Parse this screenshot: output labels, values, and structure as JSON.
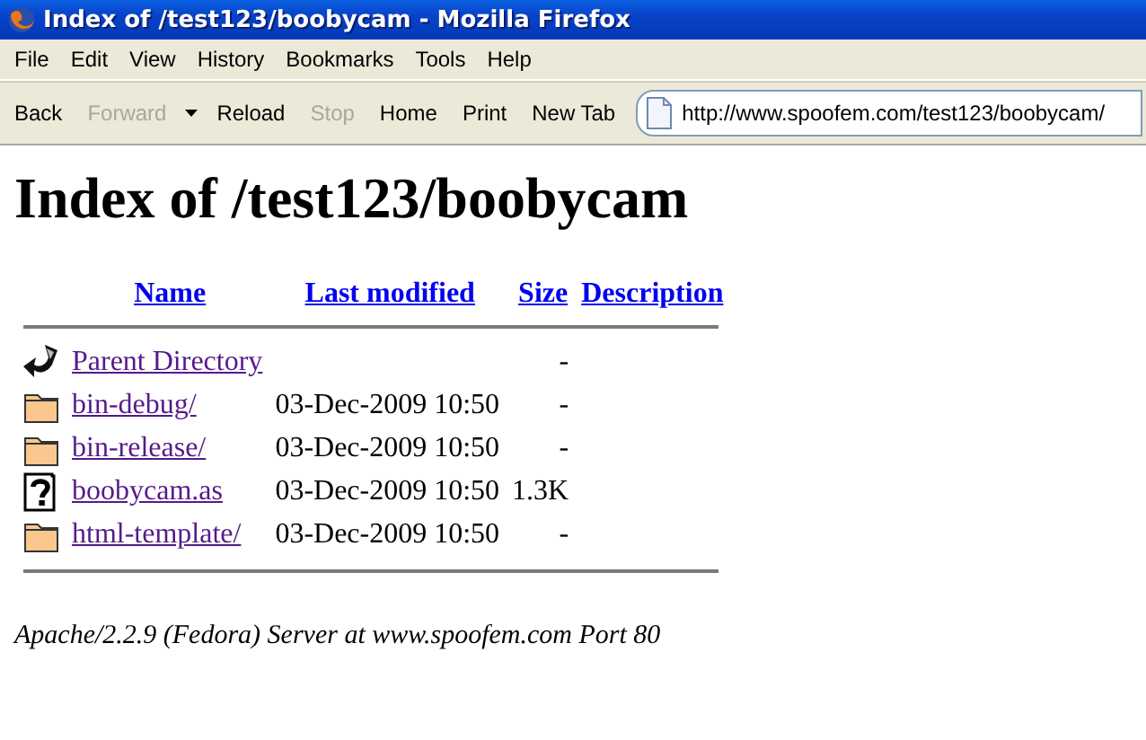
{
  "window": {
    "title": "Index of /test123/boobycam - Mozilla Firefox"
  },
  "menu": [
    "File",
    "Edit",
    "View",
    "History",
    "Bookmarks",
    "Tools",
    "Help"
  ],
  "toolbar": [
    {
      "label": "Back",
      "disabled": false
    },
    {
      "label": "Forward",
      "disabled": true
    },
    {
      "label": "Reload",
      "disabled": false
    },
    {
      "label": "Stop",
      "disabled": true
    },
    {
      "label": "Home",
      "disabled": false
    },
    {
      "label": "Print",
      "disabled": false
    },
    {
      "label": "New Tab",
      "disabled": false
    }
  ],
  "address": {
    "value": "http://www.spoofem.com/test123/boobycam/"
  },
  "page": {
    "heading": "Index of /test123/boobycam",
    "columns": [
      "Name",
      "Last modified",
      "Size",
      "Description"
    ],
    "rows": [
      {
        "kind": "parent",
        "name": "Parent Directory",
        "modified": "",
        "size": "-"
      },
      {
        "kind": "folder",
        "name": "bin-debug/",
        "modified": "03-Dec-2009 10:50",
        "size": "-"
      },
      {
        "kind": "folder",
        "name": "bin-release/",
        "modified": "03-Dec-2009 10:50",
        "size": "-"
      },
      {
        "kind": "unknown",
        "name": "boobycam.as",
        "modified": "03-Dec-2009 10:50",
        "size": "1.3K"
      },
      {
        "kind": "folder",
        "name": "html-template/",
        "modified": "03-Dec-2009 10:50",
        "size": "-"
      }
    ],
    "footer": "Apache/2.2.9 (Fedora) Server at www.spoofem.com Port 80"
  }
}
